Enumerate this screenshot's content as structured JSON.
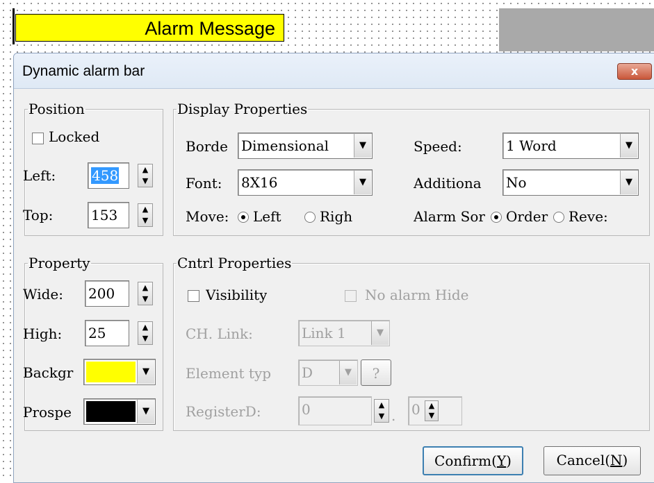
{
  "preview": {
    "alarm_text": "Alarm Message",
    "background": "#ffff00"
  },
  "dialog": {
    "title": "Dynamic alarm bar",
    "close_label": "x",
    "position": {
      "legend": "Position",
      "locked_label": "Locked",
      "locked_checked": false,
      "left_label": "Left:",
      "left_value": "458",
      "top_label": "Top:",
      "top_value": "153"
    },
    "display": {
      "legend": "Display Properties",
      "border_label": "Borde",
      "border_value": "Dimensional",
      "font_label": "Font:",
      "font_value": "8X16",
      "move_label": "Move:",
      "move_left": "Left",
      "move_right": "Righ",
      "move_selected": "Left",
      "speed_label": "Speed:",
      "speed_value": "1 Word",
      "additional_label": "Additiona",
      "additional_value": "No",
      "alarm_sort_label": "Alarm Sor",
      "sort_order": "Order",
      "sort_reverse": "Reve:",
      "sort_selected": "Order"
    },
    "property": {
      "legend": "Property",
      "wide_label": "Wide:",
      "wide_value": "200",
      "high_label": "High:",
      "high_value": "25",
      "background_label": "Backgr",
      "background_color": "#ffff00",
      "prospect_label": "Prospe",
      "prospect_color": "#000000"
    },
    "cntrl": {
      "legend": "Cntrl Properties",
      "visibility_label": "Visibility",
      "visibility_checked": false,
      "no_alarm_hide_label": "No alarm Hide",
      "ch_link_label": "CH. Link:",
      "ch_link_value": "Link 1",
      "element_type_label": "Element typ",
      "element_type_value": "D",
      "element_type_help": "?",
      "register_label": "RegisterD:",
      "register_value": "0",
      "register_sep": ".",
      "register_bit": "0"
    },
    "buttons": {
      "confirm_prefix": "Confirm(",
      "confirm_key": "Y",
      "confirm_suffix": ")",
      "cancel_prefix": "Cancel(",
      "cancel_key": "N",
      "cancel_suffix": ")"
    }
  }
}
